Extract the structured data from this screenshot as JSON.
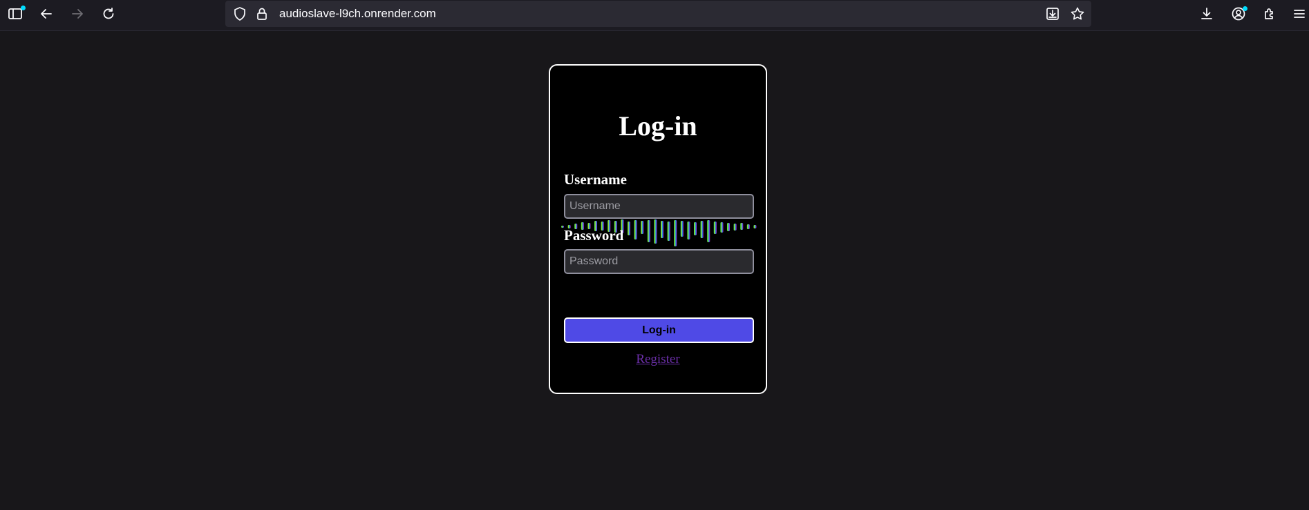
{
  "browser": {
    "url": "audioslave-l9ch.onrender.com",
    "accent": "#00ddff"
  },
  "login": {
    "title": "Log-in",
    "username_label": "Username",
    "username_placeholder": "Username",
    "username_value": "",
    "password_label": "Password",
    "password_placeholder": "Password",
    "password_value": "",
    "submit_label": "Log-in",
    "register_link": "Register",
    "button_color": "#4f4ae6",
    "link_color": "#6b2fa8"
  }
}
